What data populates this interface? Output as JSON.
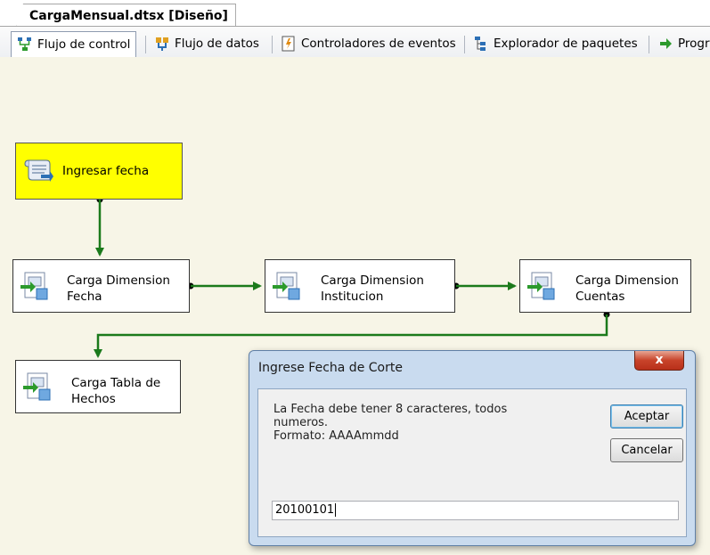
{
  "document_tab": {
    "title": "CargaMensual.dtsx [Diseño]"
  },
  "designer_tabs": [
    {
      "label": "Flujo de control",
      "icon": "control-flow-icon",
      "active": true
    },
    {
      "label": "Flujo de datos",
      "icon": "data-flow-icon",
      "active": false
    },
    {
      "label": "Controladores de eventos",
      "icon": "event-handlers-icon",
      "active": false
    },
    {
      "label": "Explorador de paquetes",
      "icon": "package-explorer-icon",
      "active": false
    },
    {
      "label": "Progr",
      "icon": "progress-arrow-icon",
      "active": false
    }
  ],
  "tasks": {
    "ingresar_fecha": {
      "label": "Ingresar fecha",
      "icon": "script-task-icon"
    },
    "dim_fecha": {
      "label_line1": "Carga Dimension",
      "label_line2": "Fecha",
      "icon": "data-flow-task-icon"
    },
    "dim_institucion": {
      "label_line1": "Carga Dimension",
      "label_line2": "Institucion",
      "icon": "data-flow-task-icon"
    },
    "dim_cuentas": {
      "label_line1": "Carga Dimension",
      "label_line2": "Cuentas",
      "icon": "data-flow-task-icon"
    },
    "tabla_hechos": {
      "label_line1": "Carga Tabla de",
      "label_line2": "Hechos",
      "icon": "data-flow-task-icon"
    }
  },
  "dialog": {
    "title": "Ingrese Fecha de Corte",
    "close_label": "x",
    "message_line1": "La Fecha debe tener 8 caracteres, todos",
    "message_line2": "numeros.",
    "message_line3": "Formato: AAAAmmdd",
    "accept_label": "Aceptar",
    "cancel_label": "Cancelar",
    "input_value": "20100101"
  },
  "colors": {
    "canvas": "#f7f5e7",
    "highlight_task": "#ffff00",
    "connector": "#1b7a1b",
    "dialog_frame": "#c9dbef"
  }
}
